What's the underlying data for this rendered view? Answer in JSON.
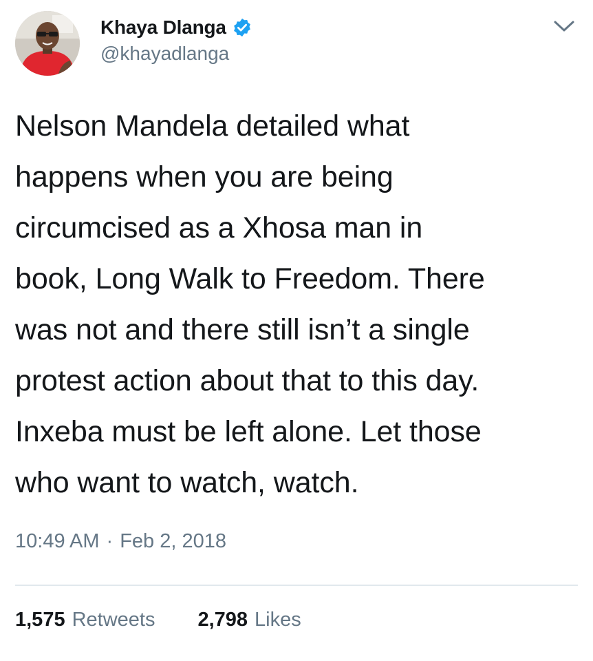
{
  "tweet": {
    "author": {
      "display_name": "Khaya Dlanga",
      "handle": "@khayadlanga",
      "verified_icon": "verified-badge-icon",
      "avatar_icon": "profile-photo"
    },
    "menu_icon": "chevron-down-icon",
    "text": "Nelson Mandela detailed what\nhappens when you are being\ncircumcised as a Xhosa man in\nbook, Long Walk to Freedom. There\nwas not and there still isn’t a single\nprotest action about that to this day.\nInxeba must be left alone. Let those\nwho want to watch, watch.",
    "time": "10:49 AM",
    "separator": "·",
    "date": "Feb 2, 2018",
    "retweets": {
      "count": "1,575",
      "label": "Retweets"
    },
    "likes": {
      "count": "2,798",
      "label": "Likes"
    }
  },
  "colors": {
    "text_primary": "#14171a",
    "text_secondary": "#657786",
    "verified_blue": "#1da1f2",
    "divider": "#e1e8ed",
    "avatar_shirt": "#e0262f"
  }
}
